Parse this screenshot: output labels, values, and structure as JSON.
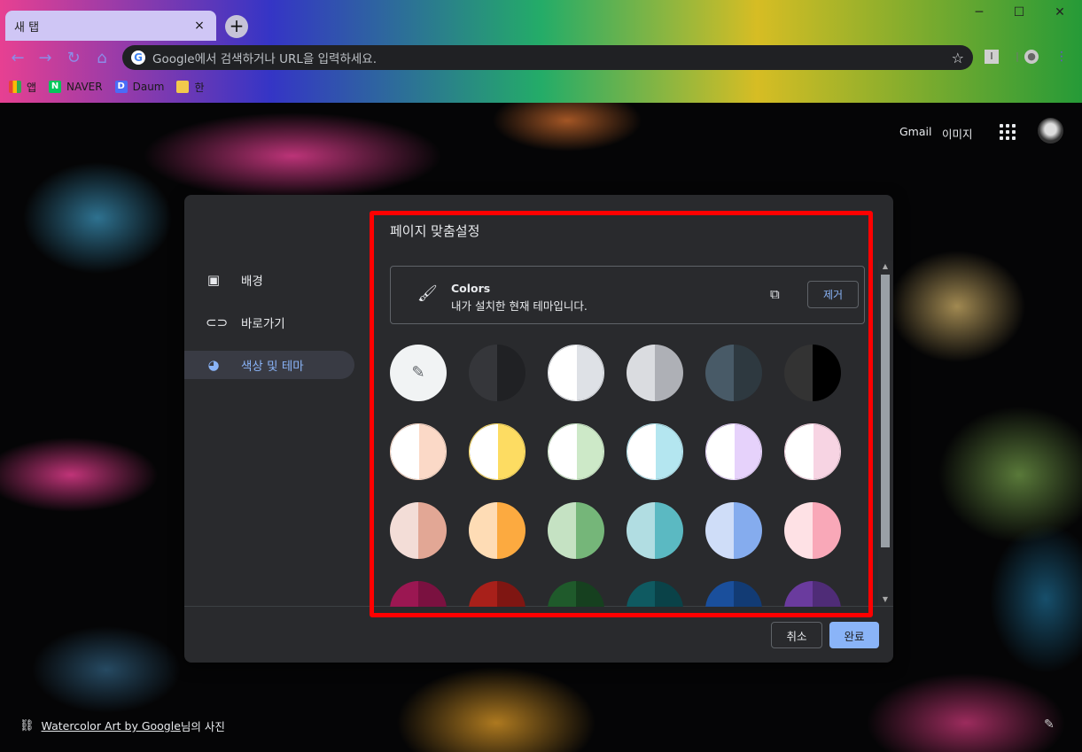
{
  "browser": {
    "tab_title": "새 탭",
    "tab_close": "×",
    "newtab": "+",
    "address_placeholder": "Google에서 검색하거나 URL을 입력하세요.",
    "google_g": "G",
    "bookmarks": [
      {
        "label": "앱",
        "icon": "apps-grid-icon"
      },
      {
        "label": "NAVER",
        "icon": "N",
        "color": "#03c75a"
      },
      {
        "label": "Daum",
        "icon": "D",
        "color": "#4a6cf7"
      },
      {
        "label": "한",
        "icon": "folder-icon",
        "color": "#f2c94c"
      }
    ]
  },
  "ntp": {
    "gmail": "Gmail",
    "images": "이미지",
    "credit_link": "Watercolor Art by Google",
    "credit_suffix": "님의 사진"
  },
  "dialog": {
    "title": "페이지 맞춤설정",
    "nav": [
      {
        "label": "배경",
        "icon": "background-image-icon",
        "active": false
      },
      {
        "label": "바로가기",
        "icon": "link-icon",
        "active": false
      },
      {
        "label": "색상 및 테마",
        "icon": "palette-icon",
        "active": true
      }
    ],
    "theme": {
      "name": "Colors",
      "description": "내가 설치한 현재 테마입니다.",
      "remove_label": "제거"
    },
    "cancel_label": "취소",
    "done_label": "완료",
    "accent": "#8ab4f8",
    "highlight_color": "#ff0000",
    "swatches": [
      [
        "picker",
        "picker"
      ],
      [
        "#35363a",
        "#202124"
      ],
      [
        "#ffffff",
        "#dee1e6"
      ],
      [
        "#dadce0",
        "#aeb0b6"
      ],
      [
        "#485a67",
        "#2e3940"
      ],
      [
        "#333333",
        "#000000"
      ],
      [
        "#ffffff",
        "#fbd9c7"
      ],
      [
        "#ffffff",
        "#fddc62"
      ],
      [
        "#ffffff",
        "#cde9c8"
      ],
      [
        "#ffffff",
        "#b4e6f0"
      ],
      [
        "#ffffff",
        "#e6d2fb"
      ],
      [
        "#ffffff",
        "#f7d4e3"
      ],
      [
        "#f3ddd7",
        "#e2a795"
      ],
      [
        "#fedcb5",
        "#fcaa40"
      ],
      [
        "#c5e2c3",
        "#75b679"
      ],
      [
        "#b1dde2",
        "#5bb9c2"
      ],
      [
        "#cfddf8",
        "#85acee"
      ],
      [
        "#fee1e5",
        "#f9a8b8"
      ],
      [
        "#9b1752",
        "#7a1140"
      ],
      [
        "#a8201a",
        "#7f1612"
      ],
      [
        "#1f5a2b",
        "#16401f"
      ],
      [
        "#0f5a61",
        "#0a4248"
      ],
      [
        "#1a4f9c",
        "#123b74"
      ],
      [
        "#6a3b9e",
        "#4f2c77"
      ]
    ]
  }
}
